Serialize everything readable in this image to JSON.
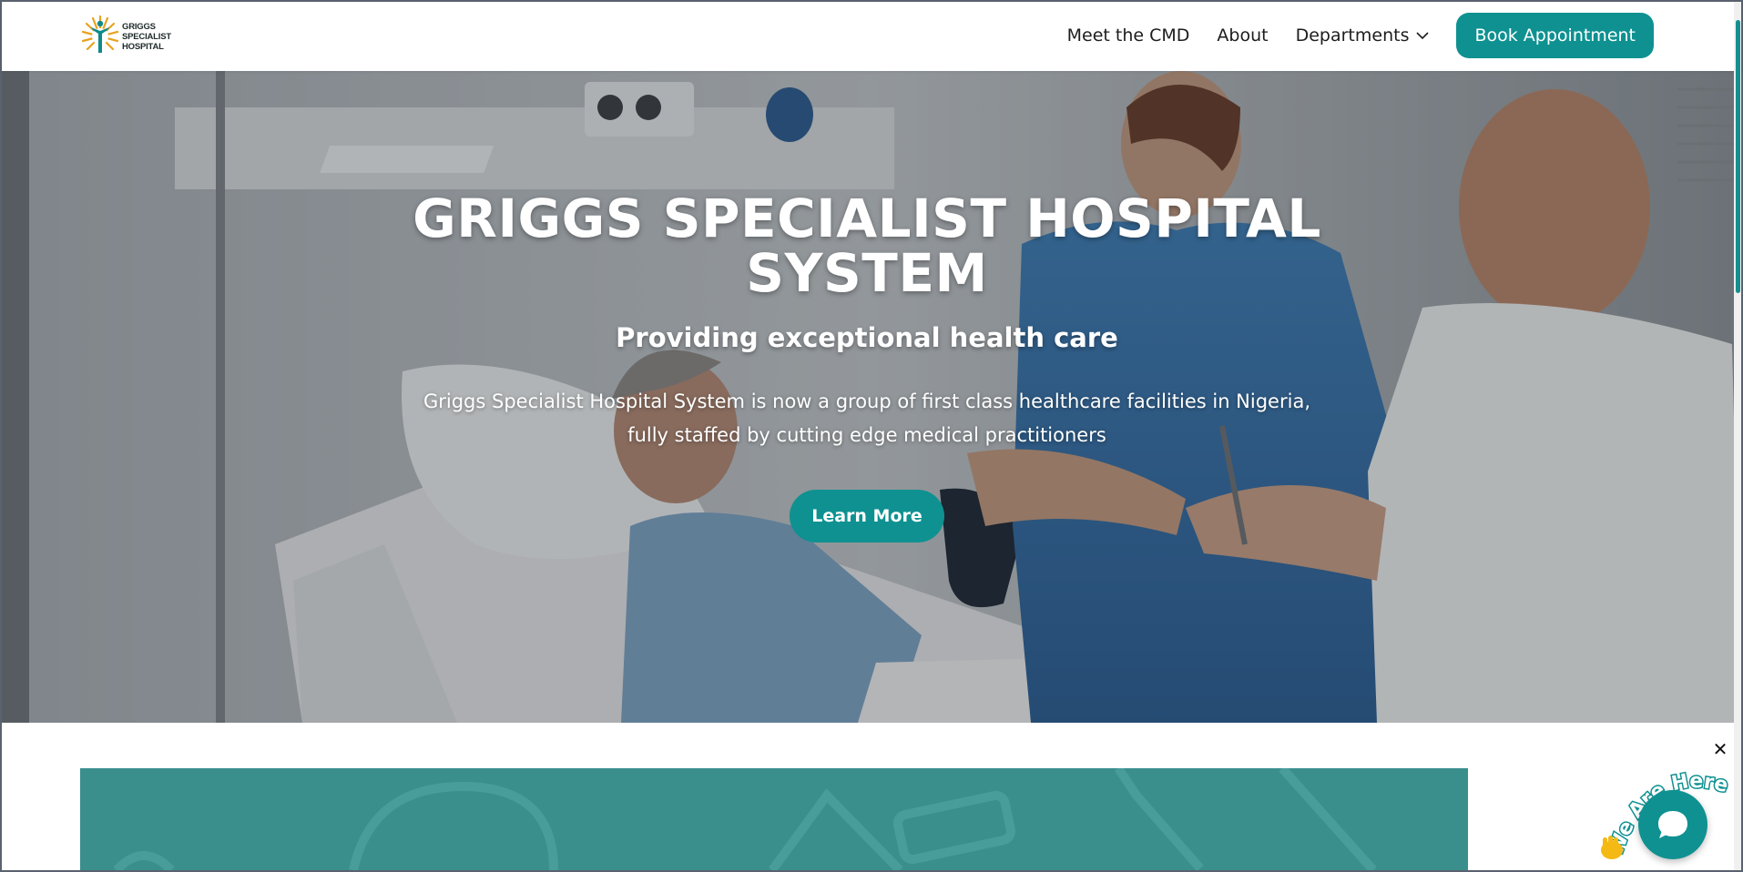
{
  "brand": {
    "logo_lines": [
      "GRIGGS",
      "SPECIALIST",
      "HOSPITAL"
    ],
    "primary_color": "#0f9191"
  },
  "nav": {
    "items": [
      {
        "label": "Meet the CMD"
      },
      {
        "label": "About"
      },
      {
        "label": "Departments",
        "icon": "chevron-down-icon"
      }
    ],
    "cta_label": "Book Appointment"
  },
  "hero": {
    "title_lines": [
      "GRIGGS SPECIALIST HOSPITAL",
      "SYSTEM"
    ],
    "subtitle": "Providing exceptional health care",
    "description_lines": [
      "Griggs Specialist Hospital System is now a group of first class healthcare facilities in Nigeria,",
      "fully staffed by cutting edge medical practitioners"
    ],
    "button_label": "Learn More"
  },
  "chat_widget": {
    "tag_text": "We Are Here!",
    "close_glyph": "✕",
    "icons": [
      "waving-hand-icon",
      "chat-bubble-icon"
    ]
  }
}
